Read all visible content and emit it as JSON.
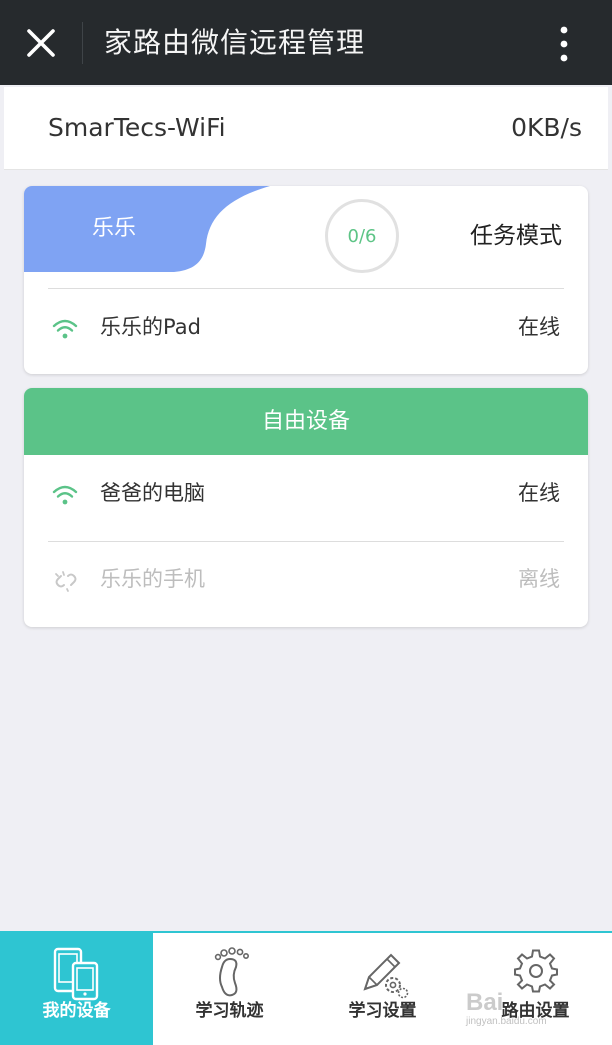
{
  "header": {
    "title": "家路由微信远程管理",
    "close_icon": "close-icon",
    "more_icon": "more-vertical-icon"
  },
  "router": {
    "ssid": "SmarTecs-WiFi",
    "speed": "0KB/s"
  },
  "task_card": {
    "owner": "乐乐",
    "progress": "0/6",
    "mode_label": "任务模式",
    "accent_color": "#7fa3f3",
    "devices": [
      {
        "name": "乐乐的Pad",
        "status": "在线",
        "icon": "wifi-icon"
      }
    ]
  },
  "free_card": {
    "title": "自由设备",
    "accent_color": "#5bc388",
    "devices": [
      {
        "name": "爸爸的电脑",
        "status": "在线",
        "icon": "wifi-icon"
      },
      {
        "name": "乐乐的手机",
        "status": "离线",
        "icon": "broken-link-icon"
      }
    ]
  },
  "tabs": [
    {
      "label": "我的设备",
      "icon": "devices-icon",
      "active": true
    },
    {
      "label": "学习轨迹",
      "icon": "footprint-icon",
      "active": false
    },
    {
      "label": "学习设置",
      "icon": "pencil-gear-icon",
      "active": false
    },
    {
      "label": "路由设置",
      "icon": "gear-icon",
      "active": false
    }
  ],
  "watermark": {
    "text": "Bai",
    "sub": "jingyan.baidu.com"
  },
  "colors": {
    "topbar": "#262a2d",
    "tab_active": "#2ec5d2",
    "online_icon": "#5bc388",
    "offline_text": "#bdbdbd"
  }
}
